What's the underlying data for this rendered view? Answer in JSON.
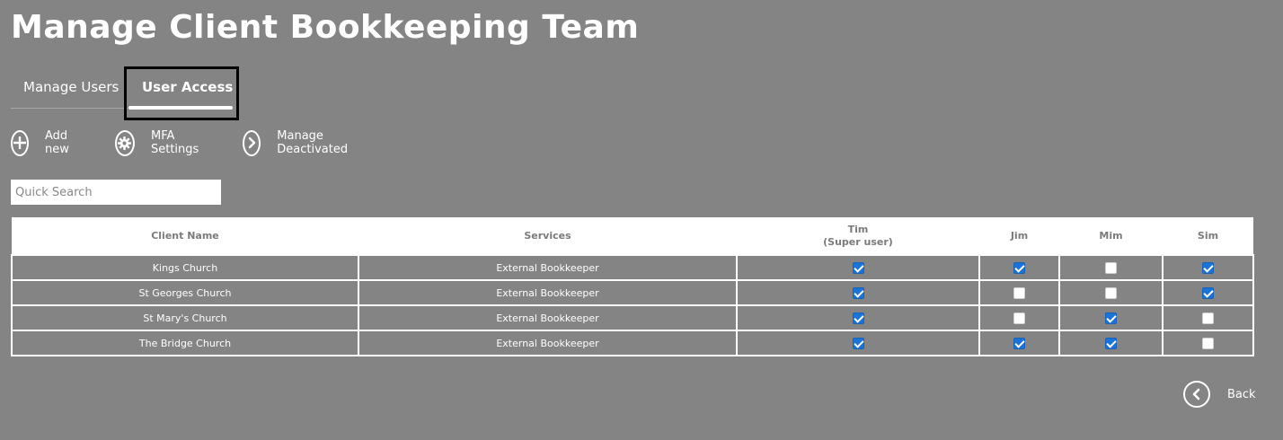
{
  "page_title": "Manage Client Bookkeeping Team",
  "tabs": {
    "manage_users": "Manage Users",
    "user_access": "User Access"
  },
  "actions": {
    "add_new": "Add new",
    "mfa_settings": "MFA Settings",
    "manage_deactivated": "Manage Deactivated"
  },
  "search": {
    "placeholder": "Quick Search",
    "value": ""
  },
  "table": {
    "headers": {
      "client_name": "Client Name",
      "services": "Services",
      "tim": "Tim",
      "tim_sub": "(Super user)",
      "jim": "Jim",
      "mim": "Mim",
      "sim": "Sim"
    },
    "rows": [
      {
        "client": "Kings Church",
        "service": "External Bookkeeper",
        "tim": true,
        "jim": true,
        "mim": false,
        "sim": true
      },
      {
        "client": "St Georges Church",
        "service": "External Bookkeeper",
        "tim": true,
        "jim": false,
        "mim": false,
        "sim": true
      },
      {
        "client": "St Mary's Church",
        "service": "External Bookkeeper",
        "tim": true,
        "jim": false,
        "mim": true,
        "sim": false
      },
      {
        "client": "The Bridge Church",
        "service": "External Bookkeeper",
        "tim": true,
        "jim": true,
        "mim": true,
        "sim": false
      }
    ]
  },
  "back_label": "Back",
  "colors": {
    "background": "#848484",
    "checkbox_checked": "#1a73d9",
    "tab_highlight_border": "#000000"
  },
  "icons": {
    "add": "plus-circle-icon",
    "mfa": "gear-icon",
    "deactivated": "chevron-right-icon",
    "back": "chevron-left-icon"
  }
}
